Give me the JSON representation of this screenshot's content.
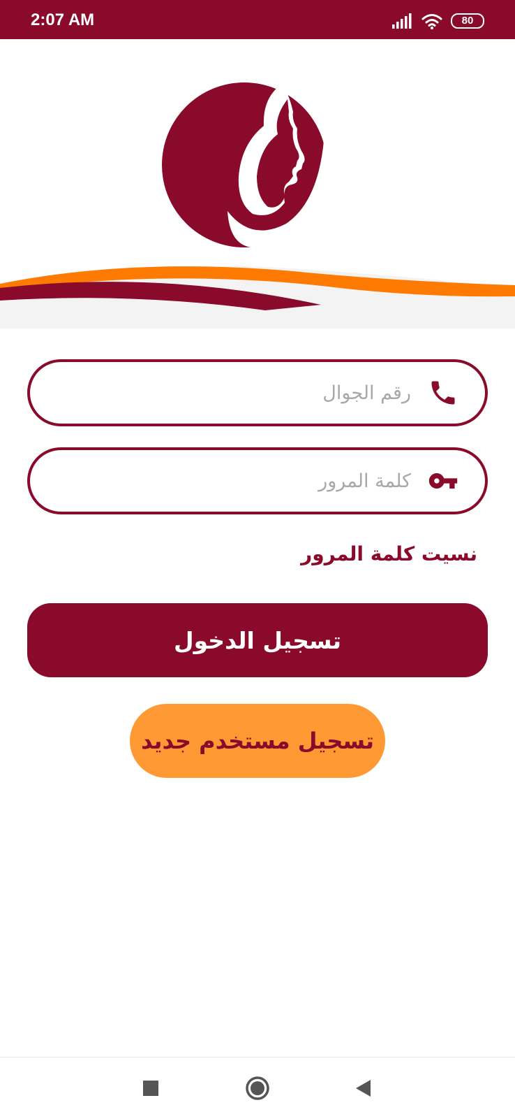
{
  "status_bar": {
    "time": "2:07 AM",
    "battery": "80",
    "icons": [
      "signal-icon",
      "wifi-icon",
      "battery-icon"
    ]
  },
  "header": {
    "logo": "woman-silhouette-logo",
    "wave_colors": [
      "#8a0a2b",
      "#ff7a00"
    ]
  },
  "form": {
    "phone": {
      "placeholder": "رقم الجوال",
      "value": "",
      "icon": "phone-icon"
    },
    "password": {
      "placeholder": "كلمة المرور",
      "value": "",
      "icon": "key-icon"
    },
    "forgot_password": "نسيت كلمة المرور",
    "login_label": "تسجيل الدخول",
    "register_label": "تسجيل مستخدم جديد"
  },
  "colors": {
    "primary": "#8a0a2b",
    "accent": "#ff9933",
    "wave_orange": "#ff7a00"
  },
  "nav_bar": {
    "buttons": [
      "recent-apps-icon",
      "home-icon",
      "back-icon"
    ]
  }
}
